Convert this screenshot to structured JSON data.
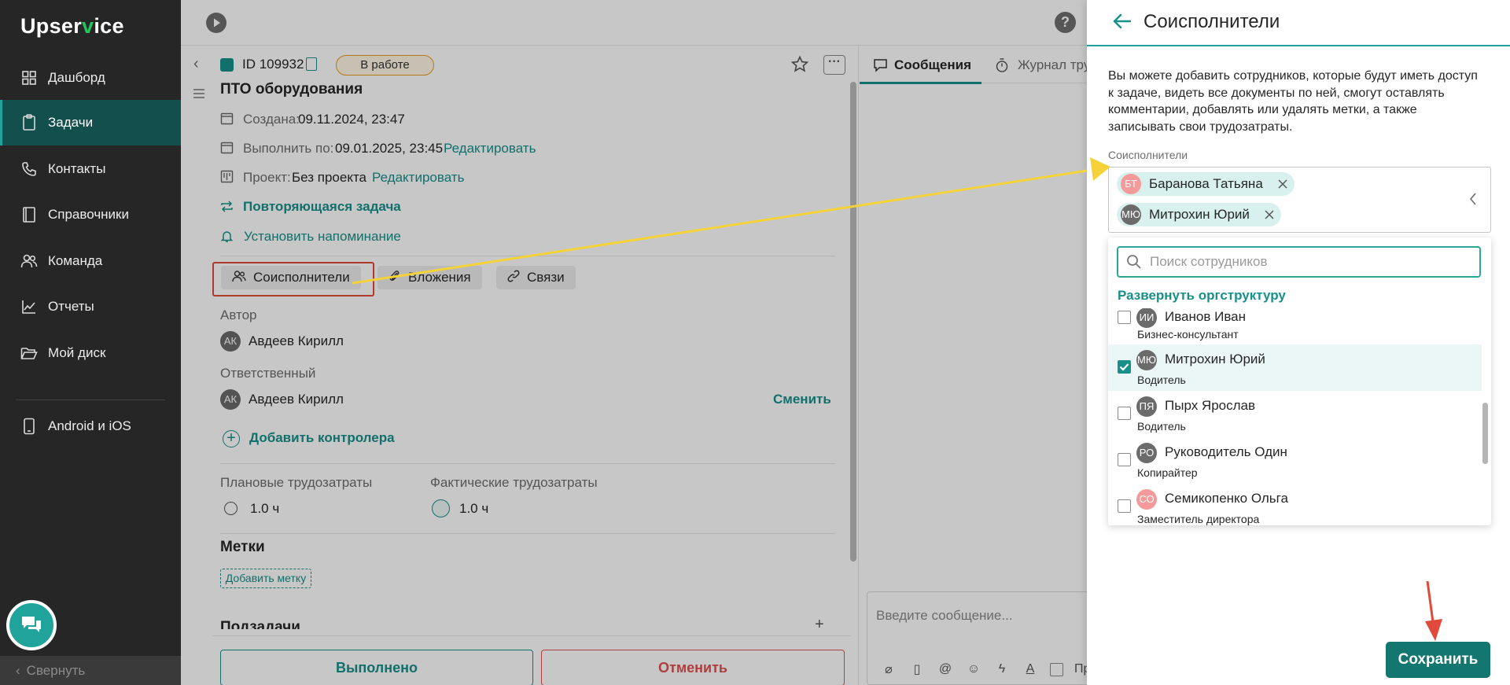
{
  "app": {
    "logo_prefix": "Upser",
    "logo_v": "v",
    "logo_suffix": "ice"
  },
  "sidebar": {
    "items": [
      {
        "label": "Дашборд",
        "icon": "dashboard-icon"
      },
      {
        "label": "Задачи",
        "icon": "tasks-icon",
        "active": true
      },
      {
        "label": "Контакты",
        "icon": "phone-icon"
      },
      {
        "label": "Справочники",
        "icon": "book-icon"
      },
      {
        "label": "Команда",
        "icon": "team-icon"
      },
      {
        "label": "Отчеты",
        "icon": "chart-icon"
      },
      {
        "label": "Мой диск",
        "icon": "folder-icon"
      },
      {
        "label": "Android и iOS",
        "icon": "mobile-icon"
      }
    ],
    "collapse_label": "Свернуть"
  },
  "task": {
    "id": "ID 109932",
    "status": "В работе",
    "title": "ПТО оборудования",
    "created_label": "Создана:",
    "created_value": "09.11.2024, 23:47",
    "due_label": "Выполнить по:",
    "due_value": "09.01.2025, 23:45",
    "due_edit": "Редактировать",
    "project_label": "Проект:",
    "project_value": "Без проекта",
    "project_edit": "Редактировать",
    "repeat_label": "Повторяющаяся задача",
    "reminder_label": "Установить напоминание",
    "tabs": {
      "coexec": "Соисполнители",
      "attach": "Вложения",
      "links": "Связи"
    },
    "author_label": "Автор",
    "author_initials": "АК",
    "author_name": "Авдеев Кирилл",
    "responsible_label": "Ответственный",
    "responsible_initials": "АК",
    "responsible_name": "Авдеев Кирилл",
    "change_label": "Сменить",
    "add_controller": "Добавить контролера",
    "planned_label": "Плановые трудозатраты",
    "planned_value": "1.0 ч",
    "actual_label": "Фактические трудозатраты",
    "actual_value": "1.0 ч",
    "tags_title": "Метки",
    "add_tag": "Добавить метку",
    "subtasks_title": "Подзадачи",
    "done_button": "Выполнено",
    "cancel_button": "Отменить"
  },
  "right_col": {
    "tab_messages": "Сообщения",
    "tab_log": "Журнал тру",
    "message_placeholder": "Введите сообщение...",
    "toolbar_cut": "Пр"
  },
  "panel": {
    "title": "Соисполнители",
    "description": "Вы можете добавить сотрудников, которые будут иметь доступ к задаче, видеть все документы по ней, смогут оставлять комментарии, добавлять или удалять метки, а также записывать свои трудозатраты.",
    "field_label": "Соисполнители",
    "chips": [
      {
        "initials": "БТ",
        "name": "Баранова Татьяна",
        "color": "#f59a9a"
      },
      {
        "initials": "МЮ",
        "name": "Митрохин Юрий",
        "color": "#6b6b6b"
      }
    ],
    "search_placeholder": "Поиск сотрудников",
    "expand_org": "Развернуть оргструктуру",
    "employees": [
      {
        "initials": "ИИ",
        "name": "Иванов Иван",
        "role": "Бизнес-консультант",
        "checked": false,
        "color": "#6b6b6b"
      },
      {
        "initials": "МЮ",
        "name": "Митрохин Юрий",
        "role": "Водитель",
        "checked": true,
        "color": "#6b6b6b"
      },
      {
        "initials": "ПЯ",
        "name": "Пырх Ярослав",
        "role": "Водитель",
        "checked": false,
        "color": "#6b6b6b"
      },
      {
        "initials": "РО",
        "name": "Руководитель Один",
        "role": "Копирайтер",
        "checked": false,
        "color": "#6b6b6b"
      },
      {
        "initials": "СО",
        "name": "Семикопенко Ольга",
        "role": "Заместитель директора",
        "checked": false,
        "color": "#f59a9a"
      }
    ],
    "save_button": "Сохранить"
  },
  "colors": {
    "accent": "#17908a",
    "sidebar_bg": "#262626",
    "active_nav": "#124f4d",
    "save_button": "#13766f",
    "status_border": "#e89b1a",
    "annotation_red": "#e04a3a",
    "annotation_yellow": "#f5d23a"
  }
}
